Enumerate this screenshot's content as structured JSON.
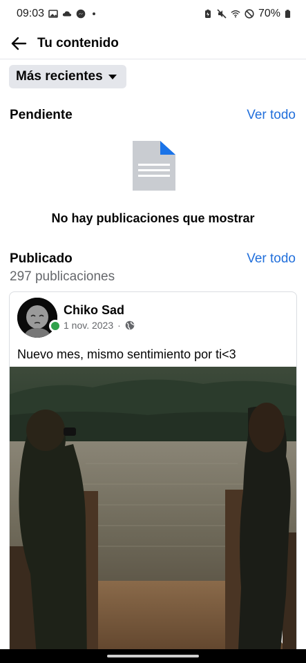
{
  "status_bar": {
    "time": "09:03",
    "battery": "70%",
    "left_icons": [
      "gallery-icon",
      "cloud-icon",
      "messenger-icon",
      "dot-icon"
    ],
    "right_icons": [
      "battery-saver-icon",
      "mute-icon",
      "wifi-icon",
      "do-not-disturb-icon",
      "battery-icon"
    ]
  },
  "header": {
    "title": "Tu contenido",
    "back_icon": "arrow-left-icon"
  },
  "filter": {
    "selected": "Más recientes"
  },
  "pending": {
    "title": "Pendiente",
    "see_all": "Ver todo",
    "empty_message": "No hay publicaciones que mostrar"
  },
  "published": {
    "title": "Publicado",
    "see_all": "Ver todo",
    "count": "297 publicaciones"
  },
  "post": {
    "author": "Chiko Sad",
    "date": "1 nov. 2023",
    "separator": "·",
    "audience_icon": "globe-icon",
    "text": "Nuevo mes, mismo sentimiento por ti<3"
  },
  "colors": {
    "link": "#216fdb",
    "chip_bg": "#e4e6eb",
    "online": "#31a24c",
    "doc_blue": "#1a73e8",
    "doc_gray": "#c9ccd1"
  }
}
